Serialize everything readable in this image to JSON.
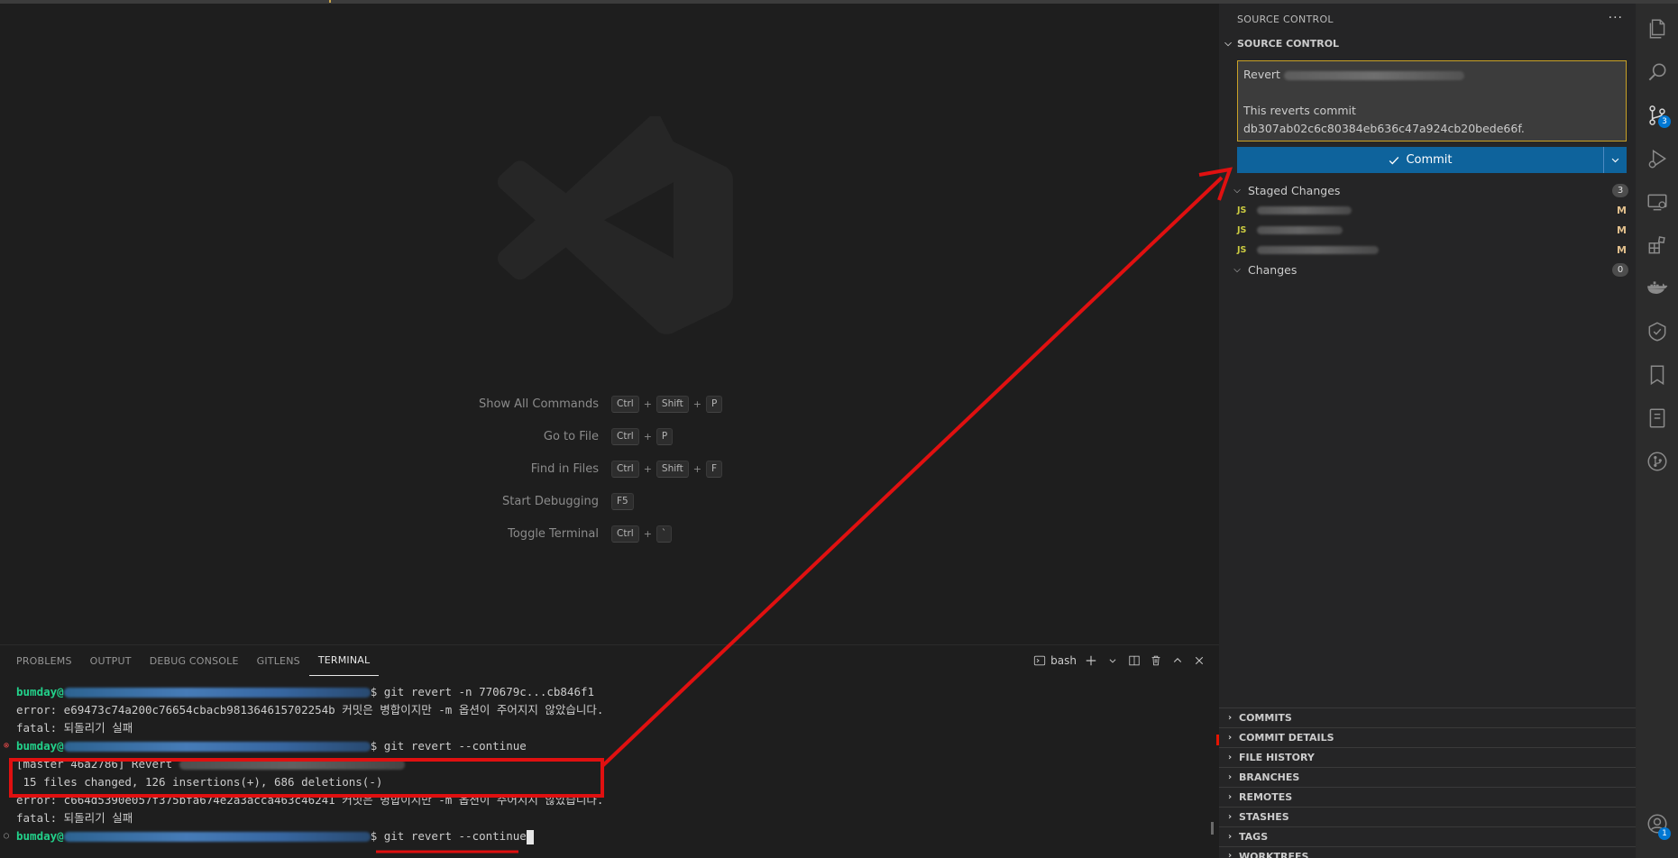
{
  "editor": {
    "shortcuts": [
      {
        "label": "Show All Commands",
        "keys": [
          "Ctrl",
          "Shift",
          "P"
        ]
      },
      {
        "label": "Go to File",
        "keys": [
          "Ctrl",
          "P"
        ]
      },
      {
        "label": "Find in Files",
        "keys": [
          "Ctrl",
          "Shift",
          "F"
        ]
      },
      {
        "label": "Start Debugging",
        "keys": [
          "F5"
        ]
      },
      {
        "label": "Toggle Terminal",
        "keys": [
          "Ctrl",
          "`"
        ]
      }
    ]
  },
  "panel": {
    "tabs": [
      "PROBLEMS",
      "OUTPUT",
      "DEBUG CONSOLE",
      "GITLENS",
      "TERMINAL"
    ],
    "active_tab": "TERMINAL",
    "shell": "bash",
    "terminal": {
      "user": "bumday@",
      "lines": [
        {
          "prompt": true,
          "cmd": "$ git revert -n 770679c...cb846f1"
        },
        {
          "text": "error: e69473c74a200c76654cbacb981364615702254b 커밋은 병합이지만 -m 옵션이 주어지지 않았습니다."
        },
        {
          "text": "fatal: 되돌리기 실패"
        },
        {
          "prompt": true,
          "cmd": "$ git revert --continue"
        },
        {
          "text": "[master 46a2786] Revert "
        },
        {
          "text": " 15 files changed, 126 insertions(+), 686 deletions(-)"
        },
        {
          "text": "error: c664d5390e057f375bfa674e2a3acca463c46241 커밋은 병합이지만 -m 옵션이 주어지지 않았습니다."
        },
        {
          "text": "fatal: 되돌리기 실패"
        },
        {
          "prompt": true,
          "cmd": "$ git revert --continue"
        }
      ]
    }
  },
  "scm": {
    "view_title": "SOURCE CONTROL",
    "section_title": "SOURCE CONTROL",
    "message_line1": "Revert",
    "message_line3": "This reverts commit",
    "message_line4": "db307ab02c6c80384eb636c47a924cb20bede66f.",
    "commit_label": "Commit",
    "staged_label": "Staged Changes",
    "staged_count": "3",
    "files": [
      {
        "type": "JS",
        "status": "M"
      },
      {
        "type": "JS",
        "status": "M"
      },
      {
        "type": "JS",
        "status": "M"
      }
    ],
    "changes_label": "Changes",
    "changes_count": "0",
    "lower_sections": [
      "COMMITS",
      "COMMIT DETAILS",
      "FILE HISTORY",
      "BRANCHES",
      "REMOTES",
      "STASHES",
      "TAGS",
      "WORKTREES"
    ]
  },
  "activity": {
    "icons": [
      "explorer-icon",
      "search-icon",
      "source-control-icon",
      "run-debug-icon",
      "remote-explorer-icon",
      "extensions-icon",
      "docker-icon",
      "gitlens-inspect-icon",
      "bookmarks-icon",
      "notebook-icon",
      "git-graph-icon"
    ],
    "scm_badge": "3",
    "account_badge": "1"
  },
  "colors": {
    "accent": "#0e639c",
    "annotation": "#e01010",
    "terminal_user": "#23d18b"
  }
}
